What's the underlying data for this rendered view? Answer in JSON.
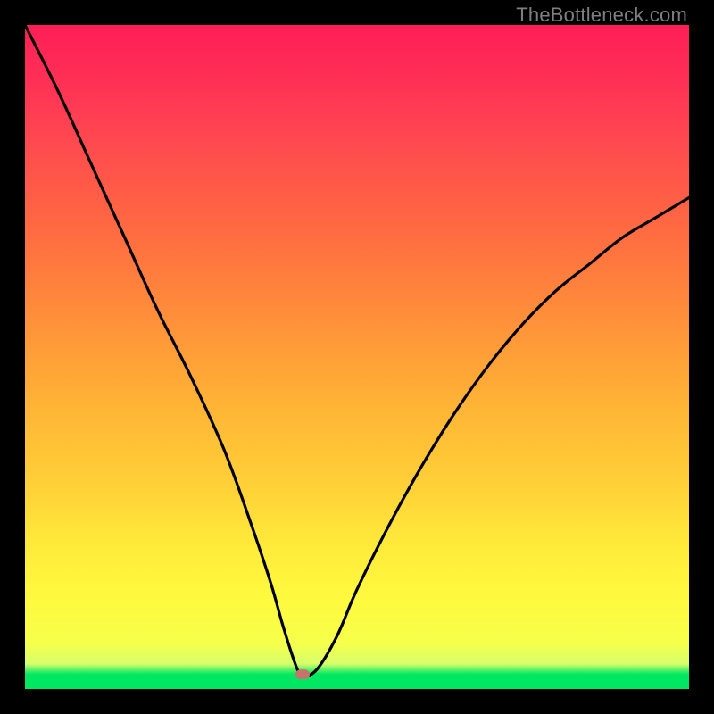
{
  "watermark": "TheBottleneck.com",
  "marker": {
    "cx_pct": 41.8,
    "cy_pct": 97.8
  },
  "chart_data": {
    "type": "line",
    "title": "",
    "xlabel": "",
    "ylabel": "",
    "xlim": [
      0,
      100
    ],
    "ylim": [
      0,
      100
    ],
    "grid": false,
    "legend": false,
    "annotations": [
      {
        "text": "TheBottleneck.com",
        "position": "top-right",
        "role": "watermark"
      }
    ],
    "series": [
      {
        "name": "bottleneck-curve",
        "x": [
          0,
          5,
          10,
          15,
          20,
          25,
          30,
          34,
          37,
          39,
          41,
          42,
          44,
          47,
          50,
          55,
          60,
          65,
          70,
          75,
          80,
          85,
          90,
          95,
          100
        ],
        "values": [
          100,
          90,
          79,
          68,
          57,
          47,
          36,
          25,
          16,
          9,
          3,
          2,
          3,
          8,
          15,
          25,
          34,
          42,
          49,
          55,
          60,
          64,
          68,
          71,
          74
        ]
      }
    ],
    "marker_point": {
      "x": 42,
      "y": 2
    },
    "background_gradient": {
      "orientation": "vertical",
      "stops": [
        {
          "pct": 0,
          "color": "#ff1e56"
        },
        {
          "pct": 50,
          "color": "#ffb535"
        },
        {
          "pct": 86,
          "color": "#fff93e"
        },
        {
          "pct": 97,
          "color": "#00e862"
        },
        {
          "pct": 100,
          "color": "#00e862"
        }
      ]
    }
  }
}
